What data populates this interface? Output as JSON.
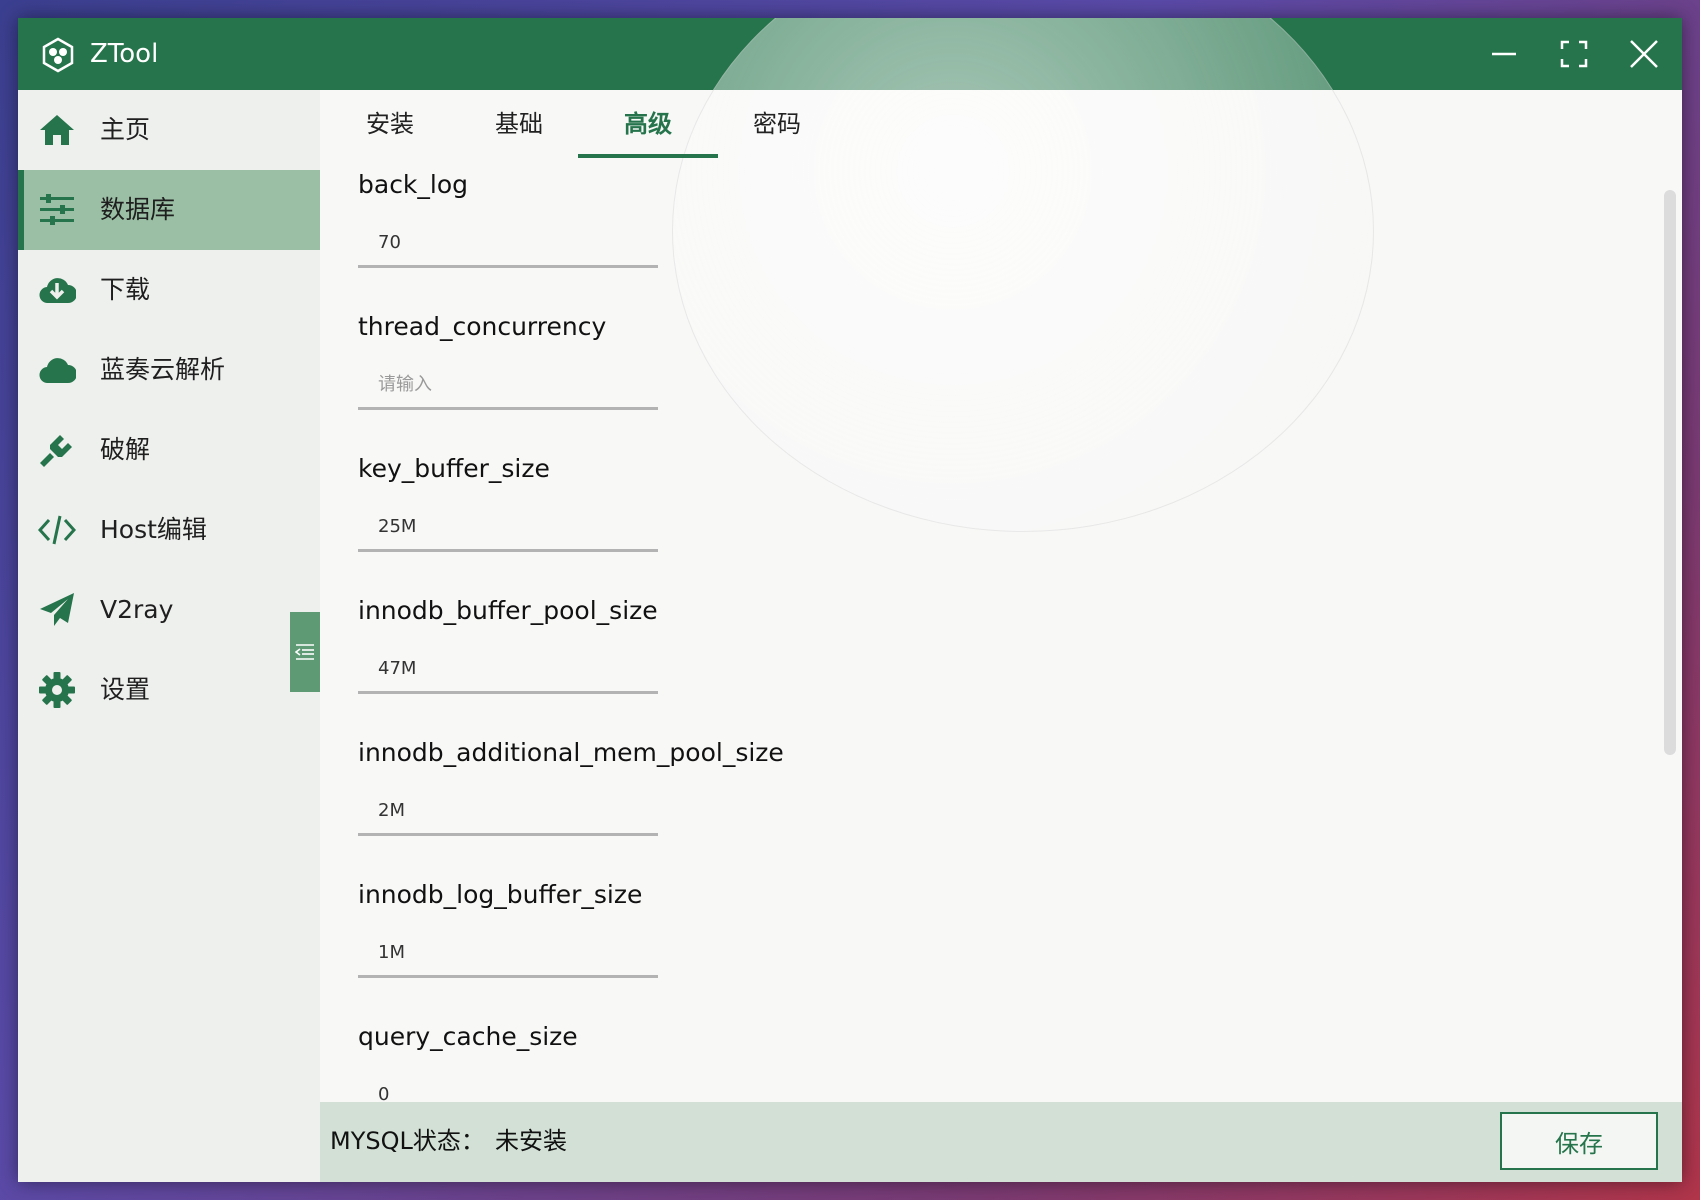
{
  "window": {
    "title": "ZTool"
  },
  "titlebar": {
    "icons": [
      "app-logo-icon",
      "minimize-icon",
      "maximize-icon",
      "close-icon"
    ]
  },
  "sidebar": {
    "items": [
      {
        "label": "主页",
        "icon": "home-icon",
        "active": false
      },
      {
        "label": "数据库",
        "icon": "sliders-icon",
        "active": true
      },
      {
        "label": "下载",
        "icon": "cloud-download-icon",
        "active": false
      },
      {
        "label": "蓝奏云解析",
        "icon": "cloud-icon",
        "active": false
      },
      {
        "label": "破解",
        "icon": "plug-icon",
        "active": false
      },
      {
        "label": "Host编辑",
        "icon": "code-icon",
        "active": false
      },
      {
        "label": "V2ray",
        "icon": "paper-plane-icon",
        "active": false
      },
      {
        "label": "设置",
        "icon": "gear-icon",
        "active": false
      }
    ]
  },
  "tabs": [
    {
      "label": "安装",
      "active": false
    },
    {
      "label": "基础",
      "active": false
    },
    {
      "label": "高级",
      "active": true
    },
    {
      "label": "密码",
      "active": false
    }
  ],
  "fields": [
    {
      "label": "back_log",
      "value": "70",
      "placeholder": "请输入"
    },
    {
      "label": "thread_concurrency",
      "value": "",
      "placeholder": "请输入"
    },
    {
      "label": "key_buffer_size",
      "value": "25M",
      "placeholder": "请输入"
    },
    {
      "label": "innodb_buffer_pool_size",
      "value": "47M",
      "placeholder": "请输入"
    },
    {
      "label": "innodb_additional_mem_pool_size",
      "value": "2M",
      "placeholder": "请输入"
    },
    {
      "label": "innodb_log_buffer_size",
      "value": "1M",
      "placeholder": "请输入"
    },
    {
      "label": "query_cache_size",
      "value": "0",
      "placeholder": "请输入"
    }
  ],
  "status": {
    "label": "MYSQL状态：",
    "value": "未安装"
  },
  "actions": {
    "save_label": "保存"
  },
  "colors": {
    "accent": "#25744b",
    "sidebar_active": "#9bbfa5",
    "statusbar": "#d2e0d5"
  }
}
